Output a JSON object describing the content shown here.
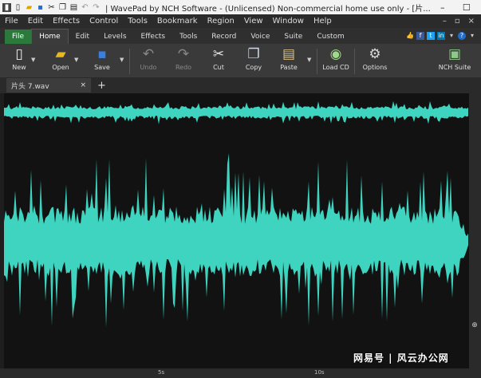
{
  "window": {
    "title": "| WavePad by NCH Software - (Unlicensed) Non-commercial home use only - [片...",
    "minimize": "–",
    "maximize": "☐",
    "close": "✕"
  },
  "menu": [
    "File",
    "Edit",
    "Effects",
    "Control",
    "Tools",
    "Bookmark",
    "Region",
    "View",
    "Window",
    "Help"
  ],
  "menu_right": [
    "–",
    "▫",
    "×"
  ],
  "tabs": [
    "File",
    "Home",
    "Edit",
    "Levels",
    "Effects",
    "Tools",
    "Record",
    "Voice",
    "Suite",
    "Custom"
  ],
  "active_tab": "Home",
  "ribbon": {
    "new": "New",
    "open": "Open",
    "save": "Save",
    "undo": "Undo",
    "redo": "Redo",
    "cut": "Cut",
    "copy": "Copy",
    "paste": "Paste",
    "load_cd": "Load CD",
    "options": "Options",
    "nch_suite": "NCH Suite"
  },
  "file_tab": {
    "name": "片头 7.wav",
    "close": "×"
  },
  "new_tab": "+",
  "timeline": {
    "t1": "5s",
    "t2": "10s"
  },
  "watermark": "网易号 | 风云办公网",
  "colors": {
    "waveform": "#3ed4bf",
    "file_tab": "#2b7a3c",
    "background": "#121212"
  }
}
